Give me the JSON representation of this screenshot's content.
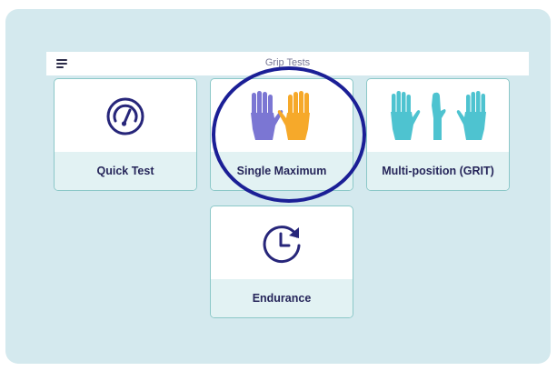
{
  "app": {
    "title": "Grip Tests"
  },
  "tests": [
    {
      "label": "Quick Test",
      "icon": "gauge-icon"
    },
    {
      "label": "Single Maximum",
      "icon": "two-hands-icon"
    },
    {
      "label": "Multi-position (GRIT)",
      "icon": "multi-hand-positions-icon"
    },
    {
      "label": "Endurance",
      "icon": "clock-timer-icon"
    }
  ],
  "colors": {
    "background": "#d4e9ee",
    "card_border": "#8cc8c8",
    "label_panel": "#e2f2f3",
    "label_text": "#26265a",
    "icon_navy": "#27267a",
    "hand_purple": "#7b76d3",
    "hand_orange": "#f6a92a",
    "hand_teal": "#4ec3d0",
    "annotation_circle": "#1b1f96"
  }
}
